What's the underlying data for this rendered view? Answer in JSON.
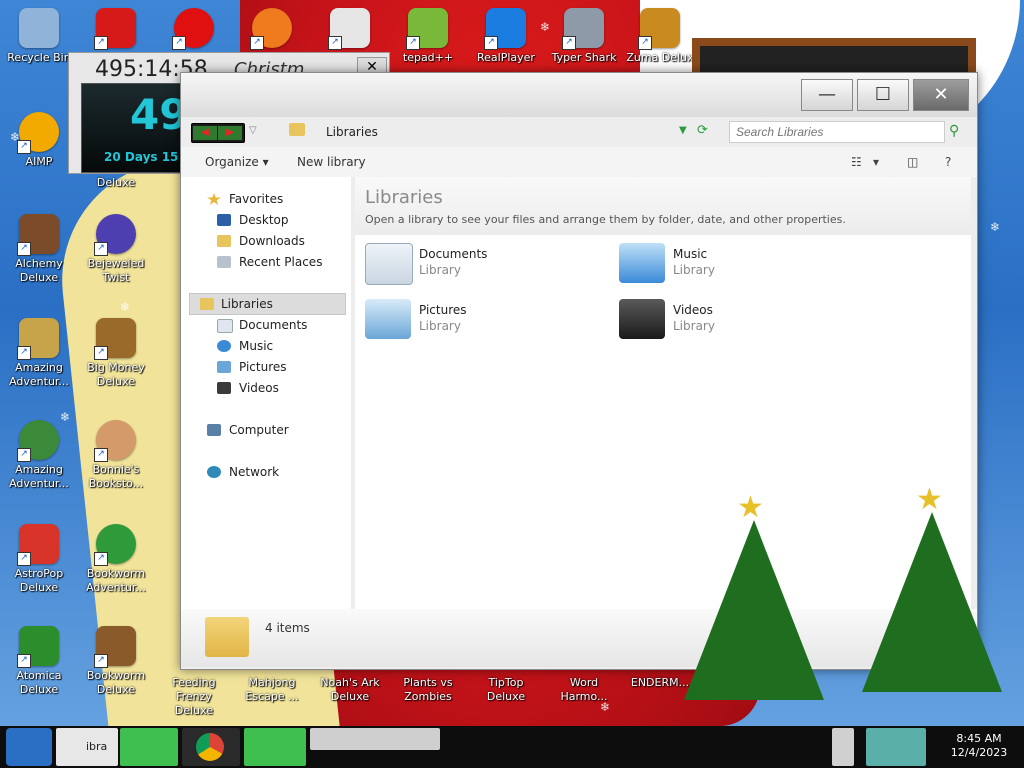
{
  "desktop": {
    "icons": [
      {
        "label": "Recycle Bin",
        "color": "#8fb3d9"
      },
      {
        "label": "",
        "color": "#d61a1a"
      },
      {
        "label": "",
        "color": "#e01010"
      },
      {
        "label": "",
        "color": "#f07a1e"
      },
      {
        "label": "",
        "color": "#e6e6e6"
      },
      {
        "label": "tepad++",
        "color": "#7ab83a"
      },
      {
        "label": "RealPlayer",
        "color": "#1c7de0"
      },
      {
        "label": "Typer Shark",
        "color": "#8e9aa8"
      },
      {
        "label": "Zuma Delux",
        "color": "#c98a20"
      },
      {
        "label": "AIMP",
        "color": "#f2a900"
      },
      {
        "label": "Deluxe",
        "color": "#3b3b3b"
      },
      {
        "label": "Alchemy Deluxe",
        "color": "#7b4b2a"
      },
      {
        "label": "Bejeweled Twist",
        "color": "#4d3fb0"
      },
      {
        "label": "Amazing Adventur...",
        "color": "#c7a34a"
      },
      {
        "label": "Big Money Deluxe",
        "color": "#9a6a2a"
      },
      {
        "label": "Amazing Adventur...",
        "color": "#3a8a3a"
      },
      {
        "label": "Bonnie's Booksto...",
        "color": "#d49a6a"
      },
      {
        "label": "AstroPop Deluxe",
        "color": "#d8342a"
      },
      {
        "label": "Bookworm Adventur...",
        "color": "#2f9a3a"
      },
      {
        "label": "Atomica Deluxe",
        "color": "#2c8d2c"
      },
      {
        "label": "Bookworm Deluxe",
        "color": "#8a5a2a"
      },
      {
        "label": "Feeding Frenzy Deluxe",
        "color": "#1e7fc8"
      },
      {
        "label": "Mahjong Escape ...",
        "color": "#b43a2a"
      },
      {
        "label": "Noah's Ark Deluxe",
        "color": "#4a8a3a"
      },
      {
        "label": "Plants vs Zombies",
        "color": "#5ab53a"
      },
      {
        "label": "TipTop Deluxe",
        "color": "#3a7ad8"
      },
      {
        "label": "Word Harmo...",
        "color": "#d86a2a"
      },
      {
        "label": "ENDERM...",
        "color": "#5a2a7a"
      }
    ]
  },
  "gadget": {
    "timer": "495:14:58",
    "title": "Christm",
    "big": "49",
    "days": "20 Days 15",
    "close": "✕"
  },
  "window": {
    "minimize": "—",
    "maximize": "☐",
    "close": "✕",
    "back": "◀",
    "forward": "▶",
    "history": "▽",
    "breadcrumb": "Libraries",
    "addr_dropdown": "▼",
    "refresh": "⟳",
    "search_placeholder": "Search Libraries",
    "search_icon": "⚲",
    "toolbar": {
      "organize": "Organize ▾",
      "new_library": "New library",
      "view": "☷",
      "view_dd": "▾",
      "preview": "◫",
      "help": "?"
    },
    "nav": {
      "favorites": "Favorites",
      "desktop": "Desktop",
      "downloads": "Downloads",
      "recent": "Recent Places",
      "libraries": "Libraries",
      "documents": "Documents",
      "music": "Music",
      "pictures": "Pictures",
      "videos": "Videos",
      "computer": "Computer",
      "network": "Network"
    },
    "content": {
      "title": "Libraries",
      "subtitle": "Open a library to see your files and arrange them by folder, date, and other properties.",
      "libs": [
        {
          "name": "Documents",
          "type": "Library"
        },
        {
          "name": "Music",
          "type": "Library"
        },
        {
          "name": "Pictures",
          "type": "Library"
        },
        {
          "name": "Videos",
          "type": "Library"
        }
      ]
    },
    "details": {
      "count": "4 items"
    }
  },
  "taskbar": {
    "time": "8:45 AM",
    "date": "12/4/2023",
    "partial_label": "ibra"
  }
}
